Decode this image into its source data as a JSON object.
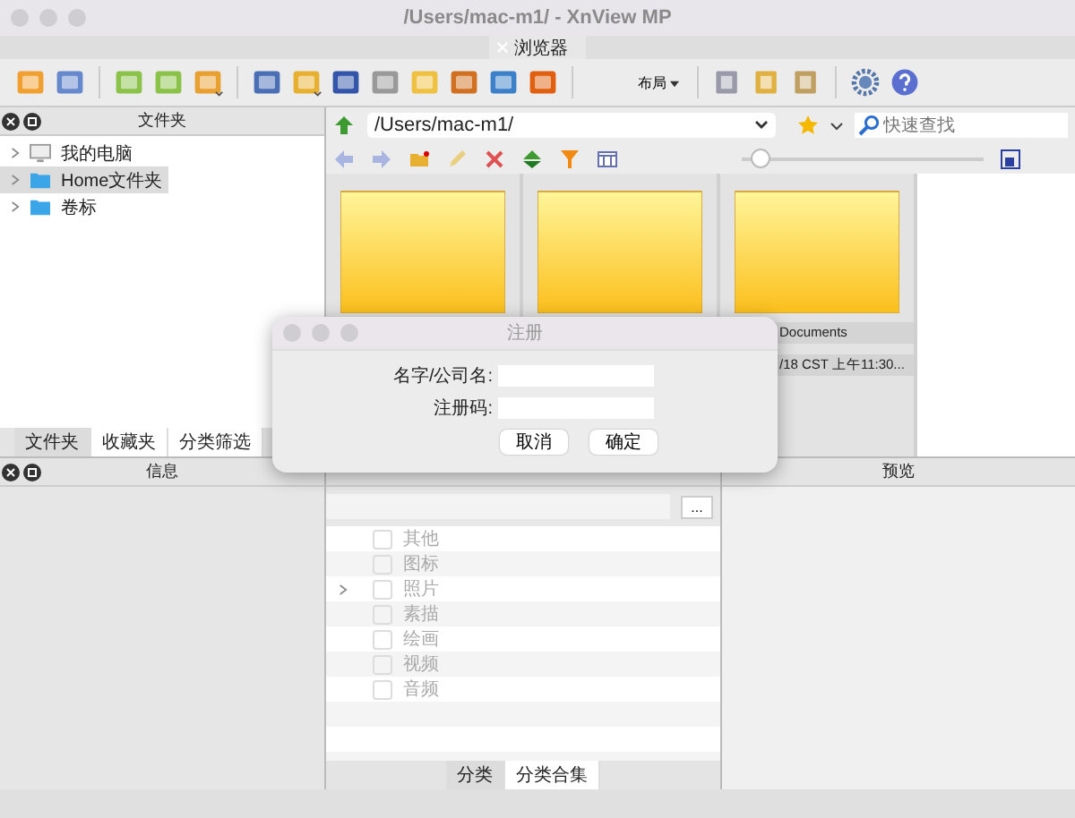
{
  "window": {
    "title": "/Users/mac-m1/ - XnView MP"
  },
  "tabs": [
    {
      "label": "浏览器",
      "selected": true
    }
  ],
  "toolbar": {
    "layout_button": "布局"
  },
  "folders_panel": {
    "title": "文件夹",
    "tree": [
      {
        "label": "我的电脑",
        "kind": "computer",
        "expanded": false,
        "selected": false
      },
      {
        "label": "Home文件夹",
        "kind": "folder",
        "expanded": false,
        "selected": true
      },
      {
        "label": "卷标",
        "kind": "folder",
        "expanded": false,
        "selected": false
      }
    ],
    "tabs": [
      {
        "label": "文件夹",
        "selected": true
      },
      {
        "label": "收藏夹",
        "selected": false
      },
      {
        "label": "分类筛选",
        "selected": false
      }
    ]
  },
  "browser": {
    "path": "/Users/mac-m1/",
    "search": {
      "placeholder": "快速查找"
    },
    "thumb_size": {
      "level": 0.08
    },
    "items": [
      {
        "kind": "folder"
      },
      {
        "kind": "folder"
      },
      {
        "kind": "folder",
        "lines": [
          "Documents",
          "/18 CST 上午11:30..."
        ]
      }
    ]
  },
  "info_panel": {
    "title": "信息"
  },
  "category_panel": {
    "filter_button": "...",
    "items": [
      {
        "label": "其他",
        "checked": false,
        "expandable": false
      },
      {
        "label": "图标",
        "checked": false,
        "expandable": false
      },
      {
        "label": "照片",
        "checked": false,
        "expandable": true
      },
      {
        "label": "素描",
        "checked": false,
        "expandable": false
      },
      {
        "label": "绘画",
        "checked": false,
        "expandable": false
      },
      {
        "label": "视频",
        "checked": false,
        "expandable": false
      },
      {
        "label": "音频",
        "checked": false,
        "expandable": false
      }
    ],
    "tabs": [
      {
        "label": "分类",
        "selected": true
      },
      {
        "label": "分类合集",
        "selected": false
      }
    ]
  },
  "preview_panel": {
    "title": "预览"
  },
  "dialog": {
    "title": "注册",
    "fields": [
      {
        "label": "名字/公司名:"
      },
      {
        "label": "注册码:"
      }
    ],
    "buttons": [
      "取消",
      "确定"
    ]
  }
}
